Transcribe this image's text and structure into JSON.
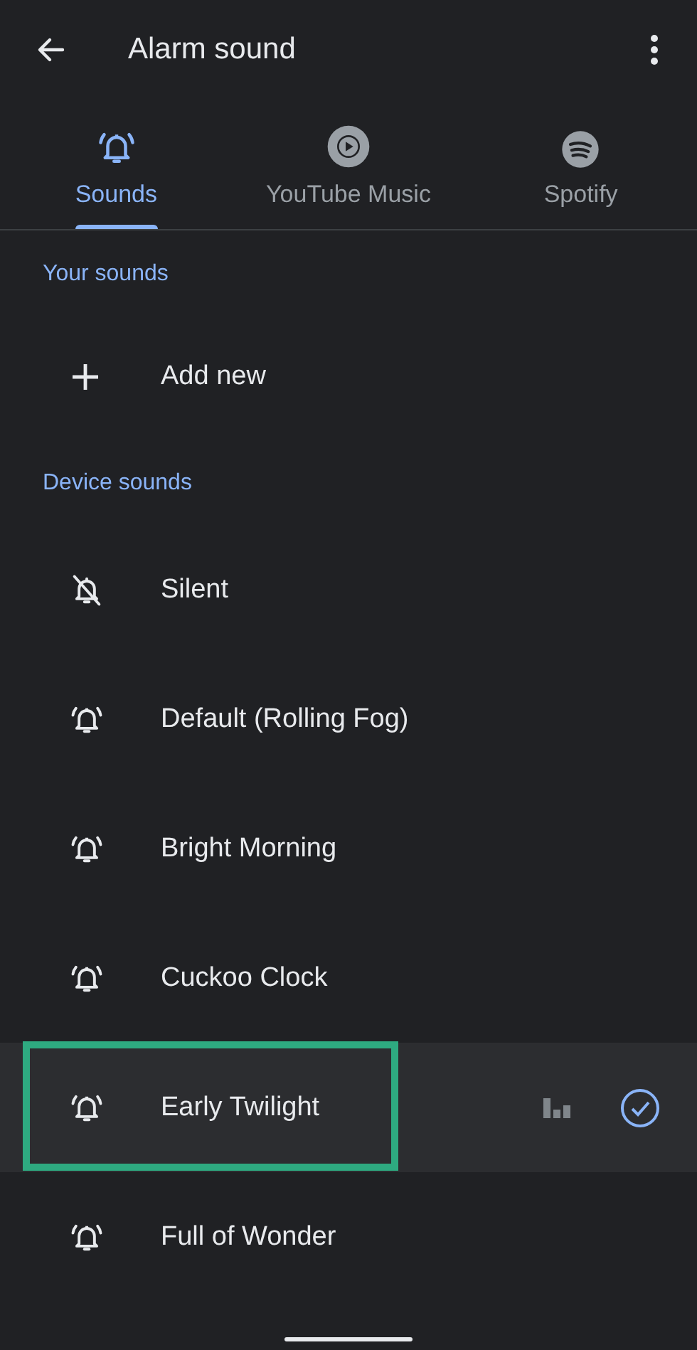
{
  "app_bar": {
    "title": "Alarm sound"
  },
  "tabs": [
    {
      "label": "Sounds",
      "kind": "bell",
      "selected": true
    },
    {
      "label": "YouTube Music",
      "kind": "play",
      "selected": false
    },
    {
      "label": "Spotify",
      "kind": "spotify",
      "selected": false
    }
  ],
  "your_sounds": {
    "header": "Your sounds",
    "add_label": "Add new"
  },
  "device_sounds": {
    "header": "Device sounds",
    "items": [
      {
        "label": "Silent",
        "kind": "silent",
        "selected": false,
        "highlighted": false
      },
      {
        "label": "Default (Rolling Fog)",
        "kind": "alarm",
        "selected": false,
        "highlighted": false
      },
      {
        "label": "Bright Morning",
        "kind": "alarm",
        "selected": false,
        "highlighted": false
      },
      {
        "label": "Cuckoo Clock",
        "kind": "alarm",
        "selected": false,
        "highlighted": false
      },
      {
        "label": "Early Twilight",
        "kind": "alarm",
        "selected": true,
        "highlighted": true
      },
      {
        "label": "Full of Wonder",
        "kind": "alarm",
        "selected": false,
        "highlighted": false
      }
    ]
  }
}
